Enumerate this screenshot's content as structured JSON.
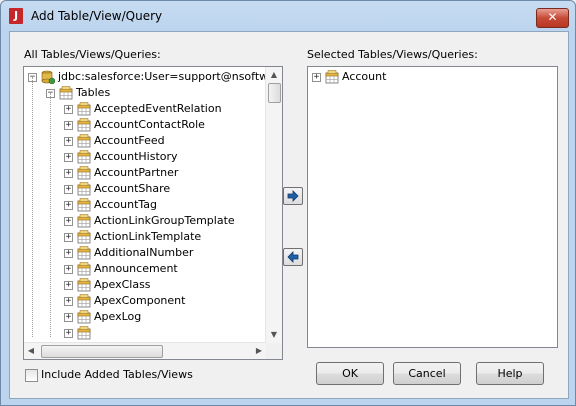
{
  "window": {
    "title": "Add Table/View/Query",
    "app_icon": "J"
  },
  "left_panel": {
    "label": "All Tables/Views/Queries:",
    "root": "jdbc:salesforce:User=support@nsoftwar",
    "tables_folder": "Tables",
    "items": [
      "AcceptedEventRelation",
      "AccountContactRole",
      "AccountFeed",
      "AccountHistory",
      "AccountPartner",
      "AccountShare",
      "AccountTag",
      "ActionLinkGroupTemplate",
      "ActionLinkTemplate",
      "AdditionalNumber",
      "Announcement",
      "ApexClass",
      "ApexComponent",
      "ApexLog"
    ]
  },
  "right_panel": {
    "label": "Selected Tables/Views/Queries:",
    "items": [
      "Account"
    ]
  },
  "checkbox": {
    "label": "Include Added Tables/Views",
    "checked": false
  },
  "buttons": {
    "ok": "OK",
    "cancel": "Cancel",
    "help": "Help"
  },
  "icons": {
    "close": "close-icon",
    "add": "arrow-right-icon",
    "remove": "arrow-left-icon",
    "database": "database-icon",
    "table": "table-icon"
  },
  "colors": {
    "arrow_blue": "#1f5fa6",
    "titlebar": "#bcd4ee",
    "close": "#c74a38"
  }
}
